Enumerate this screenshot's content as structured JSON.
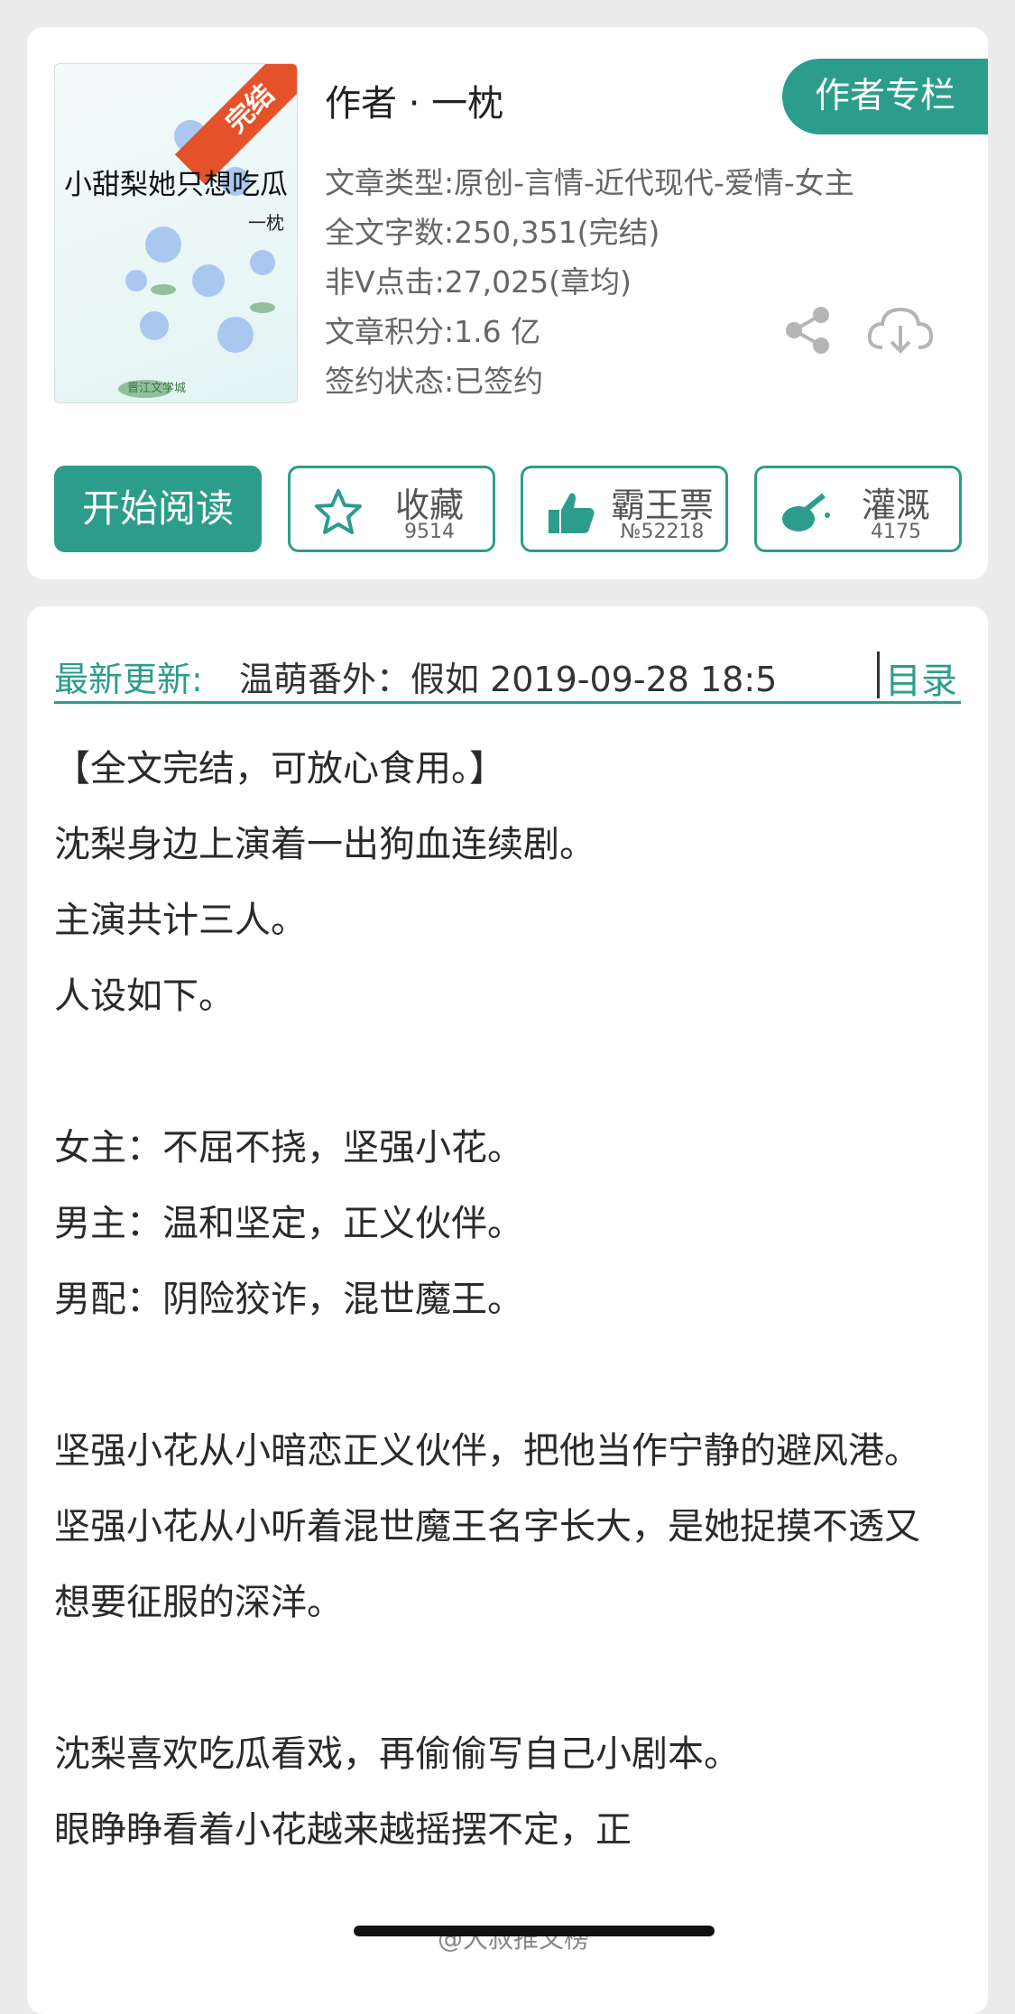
{
  "book": {
    "cover_title": "小甜梨她只想吃瓜",
    "cover_author": "一枕",
    "cover_badge": "完结",
    "cover_logo": "晋江文学城",
    "author_line": "作者 · 一枕",
    "author_column_label": "作者专栏",
    "meta": [
      "文章类型:原创-言情-近代现代-爱情-女主",
      "全文字数:250,351(完结)",
      "非Ⅴ点击:27,025(章均)",
      "文章积分:1.6 亿",
      "签约状态:已签约"
    ]
  },
  "actions": {
    "start_reading": "开始阅读",
    "favorite": {
      "label": "收藏",
      "count": "9514"
    },
    "ticket": {
      "label": "霸王票",
      "count": "№52218"
    },
    "water": {
      "label": "灌溉",
      "count": "4175"
    }
  },
  "latest_update": {
    "label": "最新更新:",
    "text": "温萌番外：假如 2019-09-28 18:5",
    "toc_label": "目录"
  },
  "summary": [
    "【全文完结，可放心食用。】",
    "沈梨身边上演着一出狗血连续剧。",
    "主演共计三人。",
    "人设如下。",
    "",
    "女主：不屈不挠，坚强小花。",
    "男主：温和坚定，正义伙伴。",
    "男配：阴险狡诈，混世魔王。",
    "",
    "坚强小花从小暗恋正义伙伴，把他当作宁静的避风港。",
    "坚强小花从小听着混世魔王名字长大，是她捉摸不透又想要征服的深洋。",
    "",
    "沈梨喜欢吃瓜看戏，再偷偷写自己小剧本。",
    "眼睁睁看着小花越来越摇摆不定，正"
  ],
  "watermark": "@大叔推文榜",
  "colors": {
    "accent": "#2c9d8a",
    "badge": "#e4512a"
  },
  "icons": [
    "share-icon",
    "download-icon",
    "star-icon",
    "thumbs-up-icon",
    "watering-icon"
  ]
}
